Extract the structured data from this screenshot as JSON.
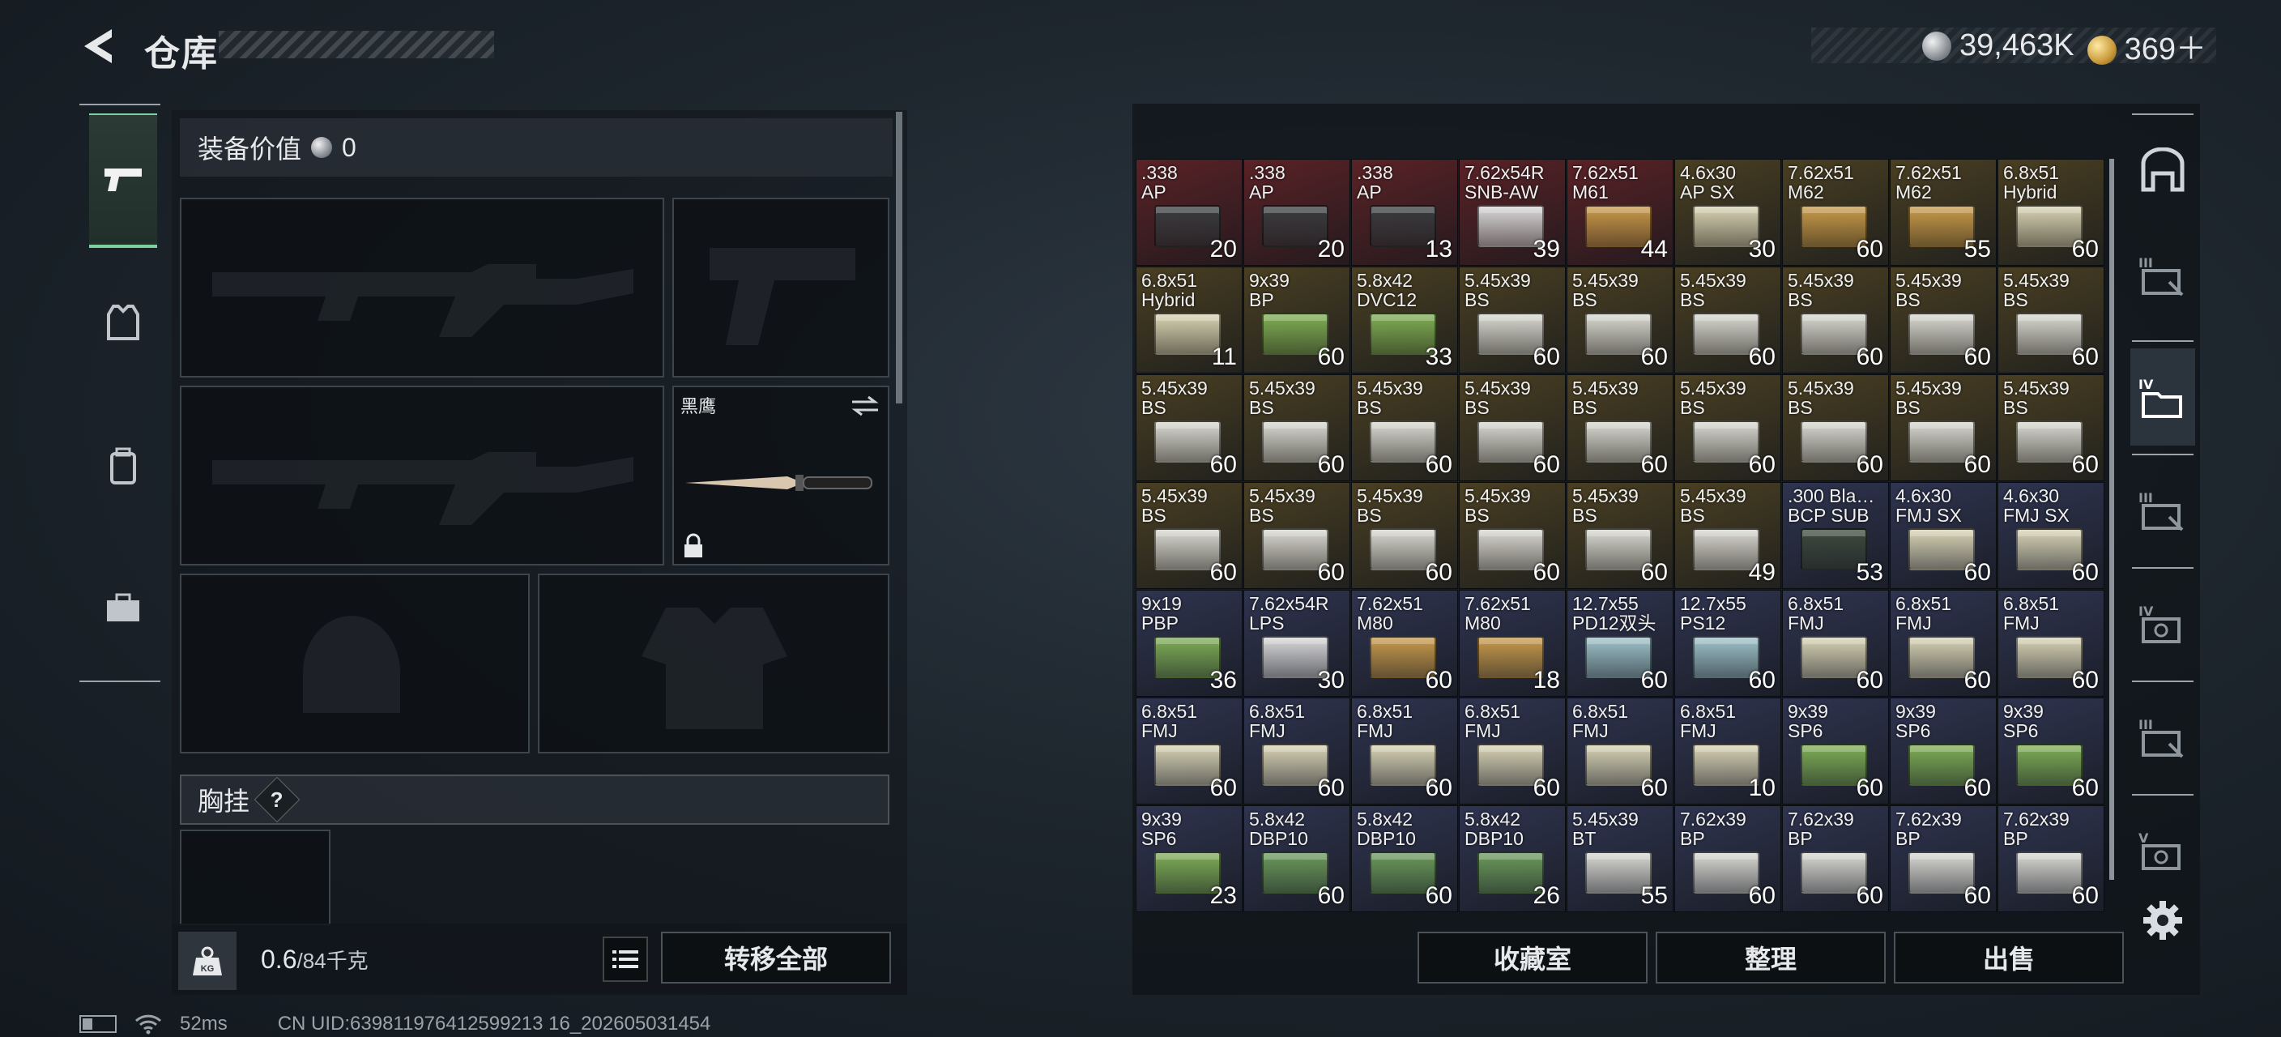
{
  "header": {
    "title": "仓库",
    "currency_silver": "39,463K",
    "currency_gold": "369＋"
  },
  "left_tabs": [
    {
      "name": "weapons",
      "icon": "pistol-icon",
      "active": true
    },
    {
      "name": "armor",
      "icon": "vest-icon",
      "active": false
    },
    {
      "name": "backpack",
      "icon": "backpack-icon",
      "active": false
    },
    {
      "name": "case",
      "icon": "toolbox-icon",
      "active": false
    }
  ],
  "loadout": {
    "equip_value_label": "装备价值",
    "equip_value": "0",
    "melee_name": "黑鹰",
    "chest_rig_label": "胸挂",
    "chest_rig_help": "?",
    "weight_current": "0.6",
    "weight_capacity": "/84千克",
    "weight_icon_text": "KG",
    "transfer_all_label": "转移全部"
  },
  "storage": {
    "buttons": {
      "collection": "收藏室",
      "sort": "整理",
      "sell": "出售"
    },
    "rows": [
      [
        {
          "name": ".338\nAP",
          "qty": "20",
          "bg": "#5a2226",
          "box": "#3a3d40"
        },
        {
          "name": ".338\nAP",
          "qty": "20",
          "bg": "#5a2226",
          "box": "#3a3d40"
        },
        {
          "name": ".338\nAP",
          "qty": "13",
          "bg": "#5a2226",
          "box": "#3a3d40"
        },
        {
          "name": "7.62x54R\nSNB-AW",
          "qty": "39",
          "bg": "#5a2226",
          "box": "#d8d8d8"
        },
        {
          "name": "7.62x51\nM61",
          "qty": "44",
          "bg": "#5a2226",
          "box": "#c99b4a"
        },
        {
          "name": "4.6x30\nAP SX",
          "qty": "30",
          "bg": "#4a3f22",
          "box": "#d8d3b4"
        },
        {
          "name": "7.62x51\nM62",
          "qty": "60",
          "bg": "#4a3f22",
          "box": "#c99b4a"
        },
        {
          "name": "7.62x51\nM62",
          "qty": "55",
          "bg": "#4a3f22",
          "box": "#c99b4a"
        },
        {
          "name": "6.8x51\nHybrid",
          "qty": "60",
          "bg": "#4a3f22",
          "box": "#d8d3b4"
        }
      ],
      [
        {
          "name": "6.8x51\nHybrid",
          "qty": "11",
          "bg": "#4a3f22",
          "box": "#d8d3b4"
        },
        {
          "name": "9x39\nBP",
          "qty": "60",
          "bg": "#4a3f22",
          "box": "#7fae55"
        },
        {
          "name": "5.8x42\nDVC12",
          "qty": "33",
          "bg": "#4a3f22",
          "box": "#7fae55"
        },
        {
          "name": "5.45x39\nBS",
          "qty": "60",
          "bg": "#4a3f22",
          "box": "#d9d9d2"
        },
        {
          "name": "5.45x39\nBS",
          "qty": "60",
          "bg": "#4a3f22",
          "box": "#d9d9d2"
        },
        {
          "name": "5.45x39\nBS",
          "qty": "60",
          "bg": "#4a3f22",
          "box": "#d9d9d2"
        },
        {
          "name": "5.45x39\nBS",
          "qty": "60",
          "bg": "#4a3f22",
          "box": "#d9d9d2"
        },
        {
          "name": "5.45x39\nBS",
          "qty": "60",
          "bg": "#4a3f22",
          "box": "#d9d9d2"
        },
        {
          "name": "5.45x39\nBS",
          "qty": "60",
          "bg": "#4a3f22",
          "box": "#d9d9d2"
        }
      ],
      [
        {
          "name": "5.45x39\nBS",
          "qty": "60",
          "bg": "#4a3f22",
          "box": "#d9d9d2"
        },
        {
          "name": "5.45x39\nBS",
          "qty": "60",
          "bg": "#4a3f22",
          "box": "#d9d9d2"
        },
        {
          "name": "5.45x39\nBS",
          "qty": "60",
          "bg": "#4a3f22",
          "box": "#d9d9d2"
        },
        {
          "name": "5.45x39\nBS",
          "qty": "60",
          "bg": "#4a3f22",
          "box": "#d9d9d2"
        },
        {
          "name": "5.45x39\nBS",
          "qty": "60",
          "bg": "#4a3f22",
          "box": "#d9d9d2"
        },
        {
          "name": "5.45x39\nBS",
          "qty": "60",
          "bg": "#4a3f22",
          "box": "#d9d9d2"
        },
        {
          "name": "5.45x39\nBS",
          "qty": "60",
          "bg": "#4a3f22",
          "box": "#d9d9d2"
        },
        {
          "name": "5.45x39\nBS",
          "qty": "60",
          "bg": "#4a3f22",
          "box": "#d9d9d2"
        },
        {
          "name": "5.45x39\nBS",
          "qty": "60",
          "bg": "#4a3f22",
          "box": "#d9d9d2"
        }
      ],
      [
        {
          "name": "5.45x39\nBS",
          "qty": "60",
          "bg": "#4a3f22",
          "box": "#d9d9d2"
        },
        {
          "name": "5.45x39\nBS",
          "qty": "60",
          "bg": "#4a3f22",
          "box": "#d9d9d2"
        },
        {
          "name": "5.45x39\nBS",
          "qty": "60",
          "bg": "#4a3f22",
          "box": "#d9d9d2"
        },
        {
          "name": "5.45x39\nBS",
          "qty": "60",
          "bg": "#4a3f22",
          "box": "#d9d9d2"
        },
        {
          "name": "5.45x39\nBS",
          "qty": "60",
          "bg": "#4a3f22",
          "box": "#d9d9d2"
        },
        {
          "name": "5.45x39\nBS",
          "qty": "49",
          "bg": "#4a3f22",
          "box": "#d9d9d2"
        },
        {
          "name": ".300 Bla…\nBCP SUB",
          "qty": "53",
          "bg": "#2f3450",
          "box": "#3d4a3d"
        },
        {
          "name": "4.6x30\nFMJ SX",
          "qty": "60",
          "bg": "#2f3450",
          "box": "#d8d3b4"
        },
        {
          "name": "4.6x30\nFMJ SX",
          "qty": "60",
          "bg": "#2f3450",
          "box": "#d8d3b4"
        }
      ],
      [
        {
          "name": "9x19\nPBP",
          "qty": "36",
          "bg": "#2f3450",
          "box": "#7fae55"
        },
        {
          "name": "7.62x54R\nLPS",
          "qty": "30",
          "bg": "#2f3450",
          "box": "#d8d8d8"
        },
        {
          "name": "7.62x51\nM80",
          "qty": "60",
          "bg": "#2f3450",
          "box": "#c99b4a"
        },
        {
          "name": "7.62x51\nM80",
          "qty": "18",
          "bg": "#2f3450",
          "box": "#c99b4a"
        },
        {
          "name": "12.7x55\nPD12双头",
          "qty": "60",
          "bg": "#2f3450",
          "box": "#9fc3c9"
        },
        {
          "name": "12.7x55\nPS12",
          "qty": "60",
          "bg": "#2f3450",
          "box": "#9fc3c9"
        },
        {
          "name": "6.8x51\nFMJ",
          "qty": "60",
          "bg": "#2f3450",
          "box": "#d8d3b4"
        },
        {
          "name": "6.8x51\nFMJ",
          "qty": "60",
          "bg": "#2f3450",
          "box": "#d8d3b4"
        },
        {
          "name": "6.8x51\nFMJ",
          "qty": "60",
          "bg": "#2f3450",
          "box": "#d8d3b4"
        }
      ],
      [
        {
          "name": "6.8x51\nFMJ",
          "qty": "60",
          "bg": "#2f3450",
          "box": "#d8d3b4"
        },
        {
          "name": "6.8x51\nFMJ",
          "qty": "60",
          "bg": "#2f3450",
          "box": "#d8d3b4"
        },
        {
          "name": "6.8x51\nFMJ",
          "qty": "60",
          "bg": "#2f3450",
          "box": "#d8d3b4"
        },
        {
          "name": "6.8x51\nFMJ",
          "qty": "60",
          "bg": "#2f3450",
          "box": "#d8d3b4"
        },
        {
          "name": "6.8x51\nFMJ",
          "qty": "60",
          "bg": "#2f3450",
          "box": "#d8d3b4"
        },
        {
          "name": "6.8x51\nFMJ",
          "qty": "10",
          "bg": "#2f3450",
          "box": "#d8d3b4"
        },
        {
          "name": "9x39\nSP6",
          "qty": "60",
          "bg": "#2f3450",
          "box": "#7fae55"
        },
        {
          "name": "9x39\nSP6",
          "qty": "60",
          "bg": "#2f3450",
          "box": "#7fae55"
        },
        {
          "name": "9x39\nSP6",
          "qty": "60",
          "bg": "#2f3450",
          "box": "#7fae55"
        }
      ],
      [
        {
          "name": "9x39\nSP6",
          "qty": "23",
          "bg": "#2f3450",
          "box": "#7fae55"
        },
        {
          "name": "5.8x42\nDBP10",
          "qty": "60",
          "bg": "#2f3450",
          "box": "#6b9a5a"
        },
        {
          "name": "5.8x42\nDBP10",
          "qty": "60",
          "bg": "#2f3450",
          "box": "#6b9a5a"
        },
        {
          "name": "5.8x42\nDBP10",
          "qty": "26",
          "bg": "#2f3450",
          "box": "#6b9a5a"
        },
        {
          "name": "5.45x39\nBT",
          "qty": "55",
          "bg": "#2f3450",
          "box": "#d9d9d2"
        },
        {
          "name": "7.62x39\nBP",
          "qty": "60",
          "bg": "#2f3450",
          "box": "#d9d9d2"
        },
        {
          "name": "7.62x39\nBP",
          "qty": "60",
          "bg": "#2f3450",
          "box": "#d9d9d2"
        },
        {
          "name": "7.62x39\nBP",
          "qty": "60",
          "bg": "#2f3450",
          "box": "#d9d9d2"
        },
        {
          "name": "7.62x39\nBP",
          "qty": "60",
          "bg": "#2f3450",
          "box": "#d9d9d2"
        }
      ]
    ]
  },
  "right_rail": [
    {
      "icon": "armory-icon",
      "active": false
    },
    {
      "icon": "storage-iii-icon",
      "active": false
    },
    {
      "icon": "storage-iv-folder-icon",
      "active": true
    },
    {
      "icon": "storage-iii-b-icon",
      "active": false
    },
    {
      "icon": "storage-iv-icon",
      "active": false
    },
    {
      "icon": "storage-iii-c-icon",
      "active": false
    },
    {
      "icon": "storage-v-icon",
      "active": false
    },
    {
      "icon": "settings-gear-icon",
      "active": false
    }
  ],
  "status_bar": {
    "ping": "52ms",
    "uid": "CN UID:639811976412599213 16_202605031454"
  }
}
